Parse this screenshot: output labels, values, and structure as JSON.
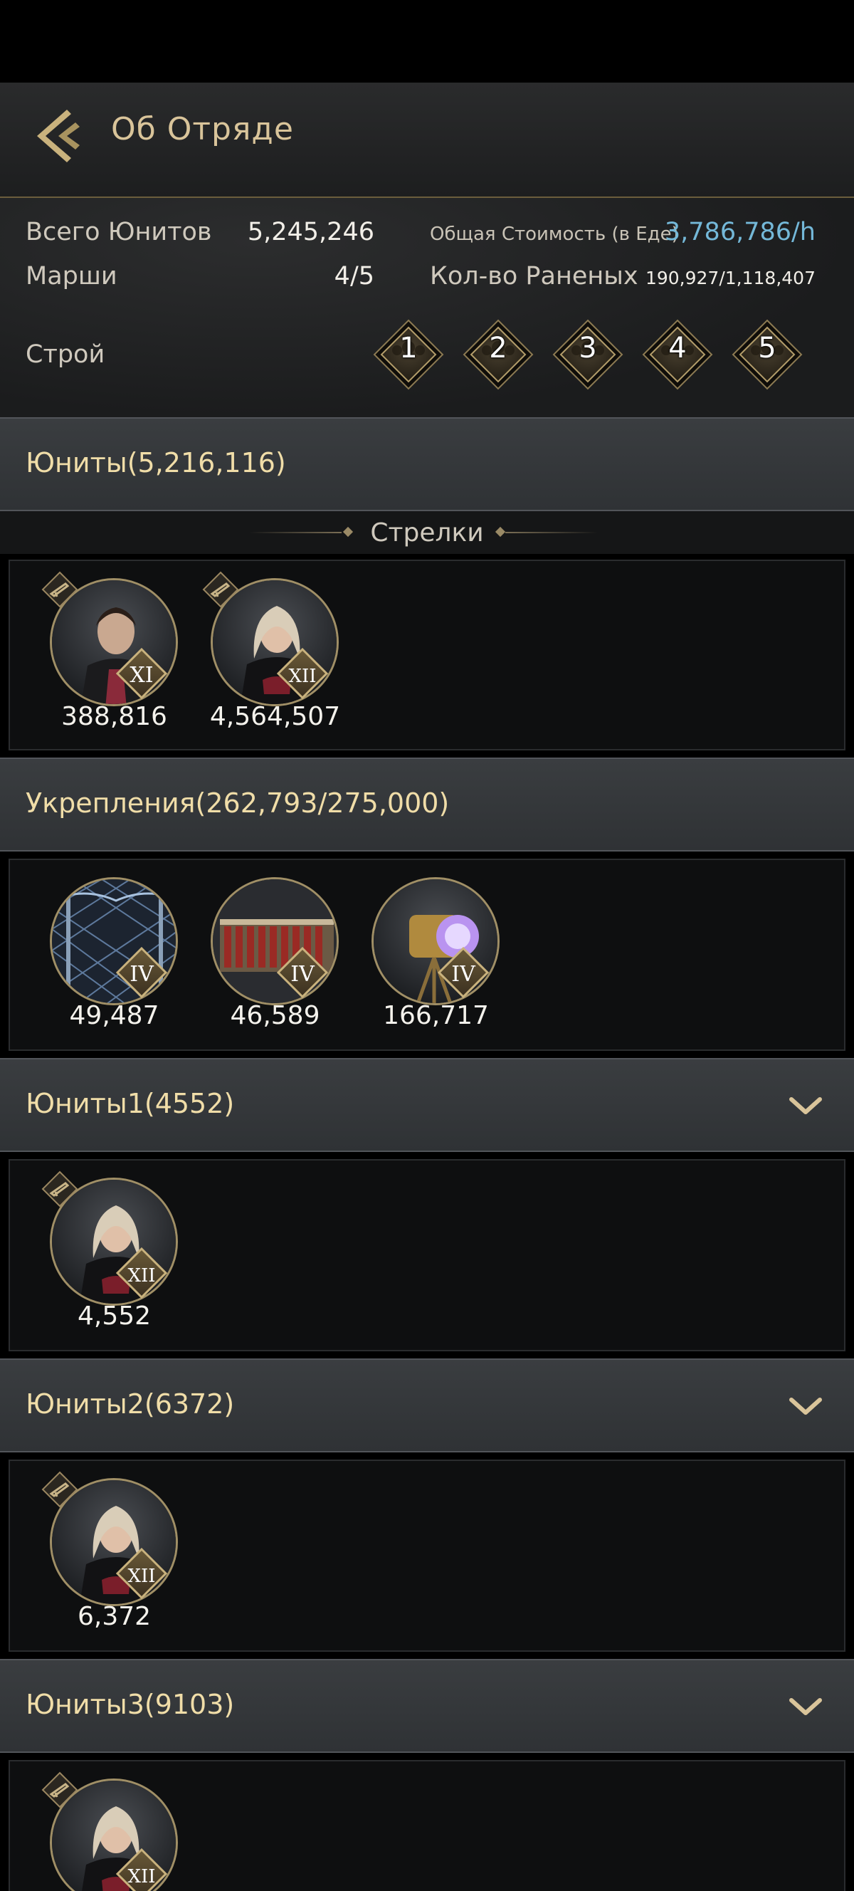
{
  "header": {
    "title": "Об Отряде"
  },
  "summary": {
    "total_units_label": "Всего Юнитов",
    "total_units_value": "5,245,246",
    "total_cost_label": "Общая Стоимость (в Еде)",
    "total_cost_value": "3,786,786/h",
    "marches_label": "Марши",
    "marches_value": "4/5",
    "wounded_label": "Кол-во Раненых",
    "wounded_value": "190,927/1,118,407",
    "formation_label": "Строй",
    "formations": [
      "1",
      "2",
      "3",
      "4",
      "5"
    ]
  },
  "sections": {
    "units": {
      "title": "Юниты(5,216,116)"
    },
    "shooters_label": "Стрелки",
    "fortifications": {
      "title": "Укрепления(262,793/275,000)"
    },
    "units1": {
      "title": "Юниты1(4552)"
    },
    "units2": {
      "title": "Юниты2(6372)"
    },
    "units3": {
      "title": "Юниты3(9103)"
    }
  },
  "unit_cards": {
    "u1": {
      "count": "388,816",
      "rank": "XI"
    },
    "u2": {
      "count": "4,564,507",
      "rank": "XII"
    },
    "f1": {
      "count": "49,487",
      "rank": "IV"
    },
    "f2": {
      "count": "46,589",
      "rank": "IV"
    },
    "f3": {
      "count": "166,717",
      "rank": "IV"
    },
    "g1": {
      "count": "4,552",
      "rank": "XII"
    },
    "g2": {
      "count": "6,372",
      "rank": "XII"
    },
    "g3": {
      "rank": "XII"
    }
  },
  "colors": {
    "accent_gold": "#d9c49a",
    "value_blue": "#74b8d8",
    "section_title": "#f0dda8"
  },
  "icons": [
    "back-chevron-icon",
    "rifle-type-icon",
    "formation-diamond-icon",
    "chevron-down-icon"
  ]
}
